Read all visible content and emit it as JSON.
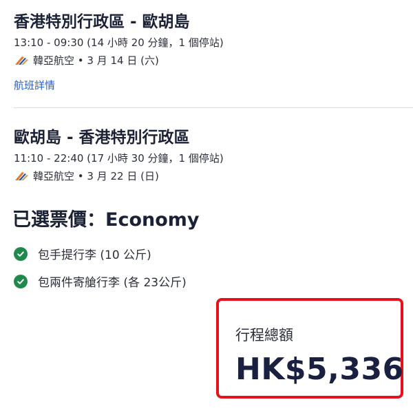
{
  "flights": [
    {
      "route": "香港特別行政區 - 歐胡島",
      "time": "13:10 - 09:30 (14 小時 20 分鐘，1 個停站)",
      "airline": "韓亞航空 • 3 月 14 日 (六)",
      "details_link": "航班詳情"
    },
    {
      "route": "歐胡島 - 香港特別行政區",
      "time": "11:10 - 22:40 (17 小時 30 分鐘，1 個停站)",
      "airline": "韓亞航空 • 3 月 22 日 (日)"
    }
  ],
  "fare": {
    "title": "已選票價：Economy",
    "items": [
      {
        "label": "包手提行李 (10 公斤)"
      },
      {
        "label": "包兩件寄艙行李 (各 23公斤)"
      }
    ]
  },
  "total": {
    "label": "行程總額",
    "amount": "HK$5,336"
  },
  "colors": {
    "link": "#1f5fd6",
    "check": "#208a4c",
    "highlight_border": "#e8101b",
    "amount": "#1a2140"
  }
}
